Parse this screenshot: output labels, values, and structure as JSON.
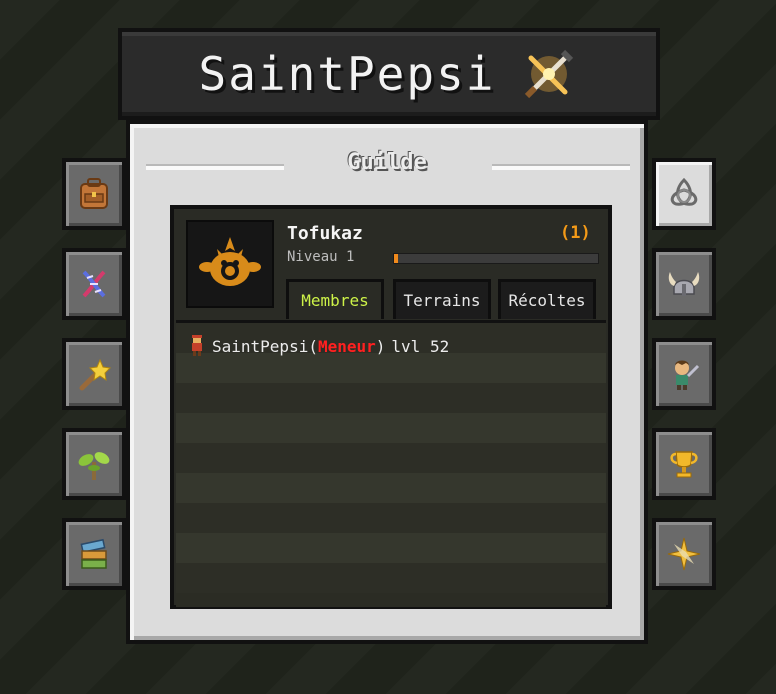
{
  "header": {
    "title": "SaintPepsi",
    "title_icon": "crossed-swords-icon"
  },
  "panel": {
    "title": "Guilde"
  },
  "guild": {
    "name": "Tofukaz",
    "member_count": "(1)",
    "level": "Niveau 1",
    "xp_progress": 0.02,
    "emblem_icon": "tofu-bird-emblem-icon"
  },
  "tabs": [
    {
      "label": "Membres",
      "active": true
    },
    {
      "label": "Terrains",
      "active": false
    },
    {
      "label": "Récoltes",
      "active": false
    }
  ],
  "members": [
    {
      "name": "SaintPepsi",
      "open": "(",
      "role": "Meneur",
      "close": ")",
      "level": "lvl 52",
      "icon": "character-icon"
    }
  ],
  "left_buttons": [
    "backpack-icon",
    "dna-icon",
    "magic-wand-icon",
    "sprout-icon",
    "books-icon"
  ],
  "right_buttons": [
    "triquetra-icon",
    "viking-helmet-icon",
    "companion-icon",
    "trophy-icon",
    "compass-star-icon"
  ],
  "colors": {
    "accent_orange": "#f39a18",
    "active_tab": "#cdf248",
    "role_red": "#ff2020"
  }
}
